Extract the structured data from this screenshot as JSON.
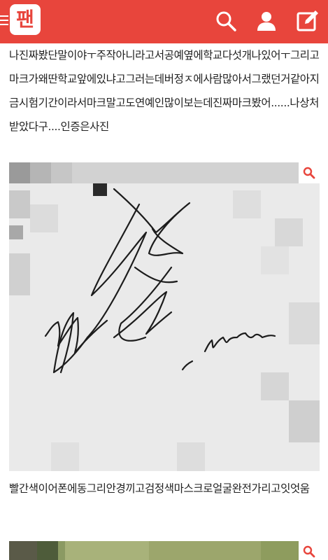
{
  "header": {
    "brand_color": "#e8453c",
    "logo_text": "팬",
    "icons": [
      "menu-icon",
      "search-icon",
      "user-icon",
      "edit-icon"
    ]
  },
  "post": {
    "paragraph_1": "나진짜봤단말이야ㅜ주작아니라고서공예옆에학교다섯개나있어ㅜ그리고마크가왜딴학교앞에있냐고그러는데버정ㅈ에사람많아서그랬던거같아지금시험기간이라서마크말고도연예인많이보는데진짜마크봤어......나상처받았다구....인증은사진",
    "photo_1": {
      "type": "autograph",
      "signature_text": "Mark"
    },
    "paragraph_2": "빨간색이어폰에동그리안경끼고검정색마스크로얼굴완전가리고잇엇움",
    "photo_2": {
      "type": "outdoor-photo"
    }
  }
}
